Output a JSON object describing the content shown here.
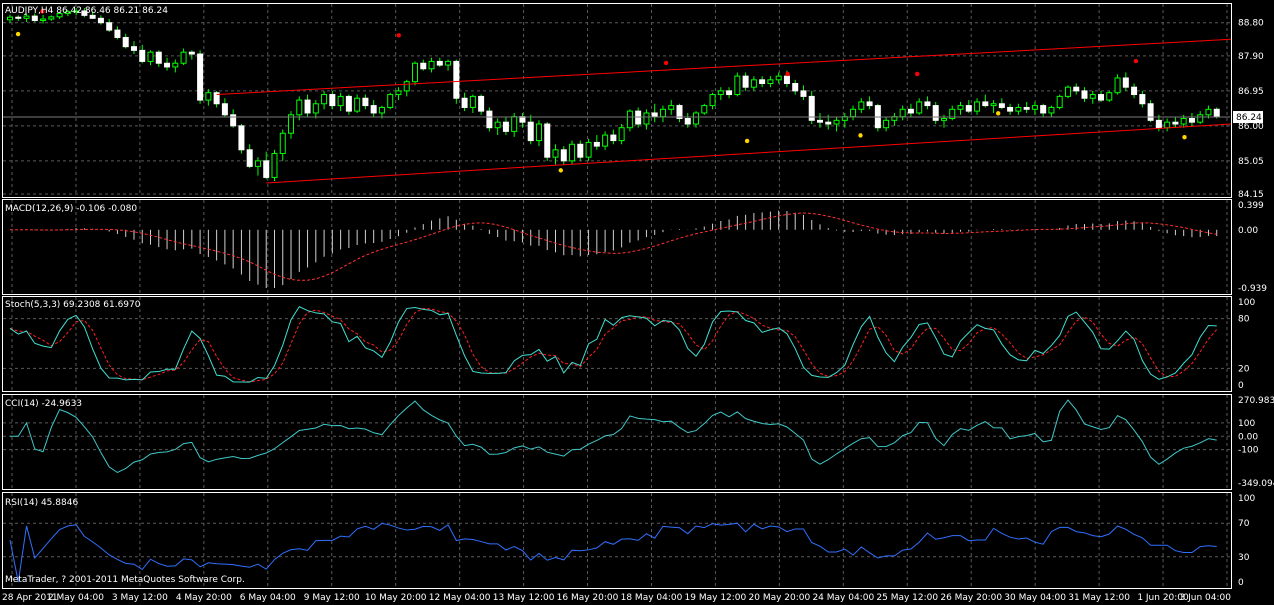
{
  "chart_data": {
    "type": "candlestick",
    "price": {
      "title": "AUDJPY,H4  86.42 86.46 86.21 86.24",
      "yticks": [
        "88.80",
        "87.90",
        "86.95",
        "86.00",
        "85.05",
        "84.15"
      ],
      "ylim": [
        84.15,
        89.2
      ],
      "current_price": "86.24",
      "candles": [
        [
          88.88,
          89.02,
          88.8,
          88.95
        ],
        [
          88.95,
          89.0,
          88.85,
          88.92
        ],
        [
          88.92,
          89.05,
          88.82,
          88.98
        ],
        [
          88.98,
          89.05,
          88.82,
          88.86
        ],
        [
          88.86,
          89.01,
          88.78,
          88.9
        ],
        [
          88.9,
          89.0,
          88.85,
          88.96
        ],
        [
          88.96,
          89.1,
          88.9,
          89.05
        ],
        [
          89.05,
          89.15,
          88.98,
          89.1
        ],
        [
          89.1,
          89.2,
          89.0,
          89.12
        ],
        [
          89.12,
          89.2,
          88.95,
          89.0
        ],
        [
          89.0,
          89.1,
          88.9,
          88.92
        ],
        [
          88.92,
          89.0,
          88.75,
          88.8
        ],
        [
          88.8,
          88.9,
          88.55,
          88.6
        ],
        [
          88.6,
          88.7,
          88.35,
          88.4
        ],
        [
          88.4,
          88.5,
          88.1,
          88.15
        ],
        [
          88.15,
          88.3,
          87.95,
          88.05
        ],
        [
          88.05,
          88.2,
          87.7,
          87.75
        ],
        [
          87.75,
          88.05,
          87.65,
          88.0
        ],
        [
          88.0,
          88.05,
          87.6,
          87.7
        ],
        [
          87.7,
          87.85,
          87.5,
          87.6
        ],
        [
          87.6,
          87.8,
          87.45,
          87.7
        ],
        [
          87.7,
          88.1,
          87.65,
          88.0
        ],
        [
          88.0,
          88.05,
          87.8,
          87.95
        ],
        [
          87.95,
          88.05,
          86.6,
          86.7
        ],
        [
          86.7,
          87.0,
          86.55,
          86.9
        ],
        [
          86.9,
          86.95,
          86.5,
          86.6
        ],
        [
          86.6,
          86.75,
          86.25,
          86.3
        ],
        [
          86.3,
          86.45,
          85.95,
          86.0
        ],
        [
          86.0,
          86.05,
          85.25,
          85.35
        ],
        [
          85.35,
          85.5,
          84.85,
          84.9
        ],
        [
          84.9,
          85.15,
          84.65,
          85.05
        ],
        [
          85.05,
          85.3,
          84.55,
          84.6
        ],
        [
          84.6,
          85.35,
          84.5,
          85.25
        ],
        [
          85.25,
          85.9,
          85.05,
          85.8
        ],
        [
          85.8,
          86.4,
          85.65,
          86.3
        ],
        [
          86.3,
          86.8,
          86.15,
          86.7
        ],
        [
          86.7,
          86.85,
          86.25,
          86.35
        ],
        [
          86.35,
          86.7,
          86.2,
          86.6
        ],
        [
          86.6,
          86.95,
          86.45,
          86.85
        ],
        [
          86.85,
          86.95,
          86.45,
          86.55
        ],
        [
          86.55,
          86.9,
          86.4,
          86.8
        ],
        [
          86.8,
          86.85,
          86.3,
          86.4
        ],
        [
          86.4,
          86.85,
          86.35,
          86.75
        ],
        [
          86.75,
          86.85,
          86.45,
          86.55
        ],
        [
          86.55,
          86.7,
          86.25,
          86.35
        ],
        [
          86.35,
          86.55,
          86.2,
          86.5
        ],
        [
          86.5,
          86.9,
          86.45,
          86.85
        ],
        [
          86.85,
          87.05,
          86.7,
          86.95
        ],
        [
          86.95,
          87.25,
          86.8,
          87.2
        ],
        [
          87.2,
          87.75,
          87.1,
          87.7
        ],
        [
          87.7,
          87.8,
          87.5,
          87.55
        ],
        [
          87.55,
          87.85,
          87.45,
          87.75
        ],
        [
          87.75,
          87.85,
          87.6,
          87.65
        ],
        [
          87.65,
          87.8,
          87.5,
          87.75
        ],
        [
          87.75,
          87.8,
          86.6,
          86.75
        ],
        [
          86.75,
          86.9,
          86.4,
          86.5
        ],
        [
          86.5,
          86.85,
          86.35,
          86.8
        ],
        [
          86.8,
          86.85,
          86.3,
          86.4
        ],
        [
          86.4,
          86.5,
          85.85,
          85.95
        ],
        [
          85.95,
          86.2,
          85.75,
          86.1
        ],
        [
          86.1,
          86.25,
          85.75,
          85.85
        ],
        [
          85.85,
          86.35,
          85.7,
          86.25
        ],
        [
          86.25,
          86.35,
          85.95,
          86.1
        ],
        [
          86.1,
          86.3,
          85.5,
          85.6
        ],
        [
          85.6,
          86.15,
          85.45,
          86.05
        ],
        [
          86.05,
          86.1,
          85.05,
          85.15
        ],
        [
          85.15,
          85.5,
          84.95,
          85.35
        ],
        [
          85.35,
          85.45,
          84.95,
          85.05
        ],
        [
          85.05,
          85.6,
          84.95,
          85.5
        ],
        [
          85.5,
          85.6,
          85.05,
          85.15
        ],
        [
          85.15,
          85.65,
          85.05,
          85.55
        ],
        [
          85.55,
          85.75,
          85.35,
          85.45
        ],
        [
          85.45,
          85.85,
          85.35,
          85.75
        ],
        [
          85.75,
          85.9,
          85.5,
          85.6
        ],
        [
          85.6,
          86.05,
          85.5,
          85.95
        ],
        [
          85.95,
          86.45,
          85.85,
          86.4
        ],
        [
          86.4,
          86.5,
          85.95,
          86.05
        ],
        [
          86.05,
          86.45,
          85.9,
          86.35
        ],
        [
          86.35,
          86.6,
          86.1,
          86.25
        ],
        [
          86.25,
          86.55,
          86.1,
          86.45
        ],
        [
          86.45,
          86.7,
          86.3,
          86.55
        ],
        [
          86.55,
          86.6,
          86.1,
          86.2
        ],
        [
          86.2,
          86.35,
          85.95,
          86.05
        ],
        [
          86.05,
          86.4,
          85.95,
          86.35
        ],
        [
          86.35,
          86.6,
          86.3,
          86.55
        ],
        [
          86.55,
          86.9,
          86.45,
          86.85
        ],
        [
          86.85,
          87.05,
          86.7,
          86.95
        ],
        [
          86.95,
          87.05,
          86.75,
          86.85
        ],
        [
          86.85,
          87.45,
          86.8,
          87.35
        ],
        [
          87.35,
          87.45,
          86.95,
          87.05
        ],
        [
          87.05,
          87.35,
          86.95,
          87.25
        ],
        [
          87.25,
          87.35,
          87.05,
          87.15
        ],
        [
          87.15,
          87.35,
          87.05,
          87.25
        ],
        [
          87.25,
          87.45,
          87.15,
          87.35
        ],
        [
          87.35,
          87.5,
          87.05,
          87.15
        ],
        [
          87.15,
          87.25,
          86.85,
          86.95
        ],
        [
          86.95,
          87.1,
          86.7,
          86.8
        ],
        [
          86.8,
          86.95,
          86.05,
          86.15
        ],
        [
          86.15,
          86.35,
          85.95,
          86.1
        ],
        [
          86.1,
          86.3,
          85.9,
          86.05
        ],
        [
          86.05,
          86.25,
          85.85,
          86.15
        ],
        [
          86.15,
          86.35,
          85.95,
          86.25
        ],
        [
          86.25,
          86.55,
          86.15,
          86.45
        ],
        [
          86.45,
          86.75,
          86.35,
          86.65
        ],
        [
          86.65,
          86.8,
          86.45,
          86.55
        ],
        [
          86.55,
          86.6,
          85.85,
          85.95
        ],
        [
          85.95,
          86.25,
          85.85,
          86.15
        ],
        [
          86.15,
          86.35,
          86.0,
          86.25
        ],
        [
          86.25,
          86.55,
          86.15,
          86.45
        ],
        [
          86.45,
          86.6,
          86.25,
          86.35
        ],
        [
          86.35,
          86.75,
          86.3,
          86.65
        ],
        [
          86.65,
          86.8,
          86.45,
          86.55
        ],
        [
          86.55,
          86.65,
          86.05,
          86.15
        ],
        [
          86.15,
          86.3,
          85.95,
          86.2
        ],
        [
          86.2,
          86.55,
          86.15,
          86.45
        ],
        [
          86.45,
          86.65,
          86.3,
          86.55
        ],
        [
          86.55,
          86.7,
          86.35,
          86.4
        ],
        [
          86.4,
          86.75,
          86.3,
          86.65
        ],
        [
          86.65,
          86.85,
          86.5,
          86.55
        ],
        [
          86.55,
          86.7,
          86.35,
          86.6
        ],
        [
          86.6,
          86.75,
          86.45,
          86.5
        ],
        [
          86.5,
          86.6,
          86.3,
          86.4
        ],
        [
          86.4,
          86.6,
          86.3,
          86.5
        ],
        [
          86.5,
          86.65,
          86.35,
          86.45
        ],
        [
          86.45,
          86.65,
          86.3,
          86.55
        ],
        [
          86.55,
          86.6,
          86.25,
          86.35
        ],
        [
          86.35,
          86.55,
          86.25,
          86.5
        ],
        [
          86.5,
          86.85,
          86.45,
          86.8
        ],
        [
          86.8,
          87.1,
          86.75,
          87.05
        ],
        [
          87.05,
          87.15,
          86.85,
          86.95
        ],
        [
          86.95,
          87.05,
          86.65,
          86.75
        ],
        [
          86.75,
          86.95,
          86.6,
          86.85
        ],
        [
          86.85,
          86.95,
          86.65,
          86.7
        ],
        [
          86.7,
          86.95,
          86.65,
          86.9
        ],
        [
          86.9,
          87.4,
          86.85,
          87.3
        ],
        [
          87.3,
          87.45,
          86.95,
          87.05
        ],
        [
          87.05,
          87.15,
          86.75,
          86.85
        ],
        [
          86.85,
          86.95,
          86.5,
          86.6
        ],
        [
          86.6,
          86.7,
          86.1,
          86.15
        ],
        [
          86.15,
          86.3,
          85.85,
          85.95
        ],
        [
          85.95,
          86.2,
          85.85,
          86.1
        ],
        [
          86.1,
          86.25,
          85.95,
          86.05
        ],
        [
          86.05,
          86.3,
          85.95,
          86.2
        ],
        [
          86.2,
          86.35,
          86.0,
          86.1
        ],
        [
          86.1,
          86.4,
          86.05,
          86.3
        ],
        [
          86.3,
          86.55,
          86.2,
          86.45
        ],
        [
          86.45,
          86.5,
          86.2,
          86.24
        ]
      ],
      "trendlines": [
        {
          "x0": 48,
          "y0": 86.85,
          "x1": 308,
          "y1": 88.35
        },
        {
          "x0": 60,
          "y0": 84.45,
          "x1": 308,
          "y1": 86.05
        }
      ],
      "up_fractals": [
        [
          4,
          89.0
        ],
        [
          48,
          88.35
        ],
        [
          81,
          87.6
        ],
        [
          96,
          87.3
        ],
        [
          112,
          87.3
        ],
        [
          139,
          87.65
        ]
      ],
      "down_fractals": [
        [
          1,
          88.6
        ],
        [
          68,
          84.9
        ],
        [
          91,
          85.7
        ],
        [
          105,
          85.85
        ],
        [
          122,
          86.45
        ],
        [
          145,
          85.8
        ]
      ]
    },
    "macd": {
      "label": "MACD(12,26,9) -0.106 -0.080",
      "yticks": [
        "0.399",
        "0.00",
        "-0.939"
      ],
      "ylim": [
        -0.939,
        0.399
      ]
    },
    "stoch": {
      "label": "Stoch(5,3,3) 69.2308 61.6970",
      "yticks": [
        "100",
        "80",
        "20",
        "0"
      ],
      "ylim": [
        0,
        100
      ]
    },
    "cci": {
      "label": "CCI(14) -24.9633",
      "yticks": [
        "270.983",
        "100",
        "0.00",
        "-100",
        "-349.094"
      ],
      "ylim": [
        -349.094,
        270.983
      ]
    },
    "rsi": {
      "label": "RSI(14) 45.8846",
      "yticks": [
        "100",
        "70",
        "30",
        "0"
      ],
      "ylim": [
        0,
        100
      ]
    },
    "x_labels": [
      "28 Apr 2011",
      "2 May 04:00",
      "3 May 12:00",
      "4 May 20:00",
      "6 May 04:00",
      "9 May 12:00",
      "10 May 20:00",
      "12 May 04:00",
      "13 May 12:00",
      "16 May 20:00",
      "18 May 04:00",
      "19 May 12:00",
      "20 May 20:00",
      "24 May 04:00",
      "25 May 12:00",
      "26 May 20:00",
      "30 May 04:00",
      "31 May 12:00",
      "1 Jun 20:00",
      "3 Jun 04:00"
    ],
    "copyright": "MetaTrader, ? 2001-2011 MetaQuotes Software Corp."
  }
}
